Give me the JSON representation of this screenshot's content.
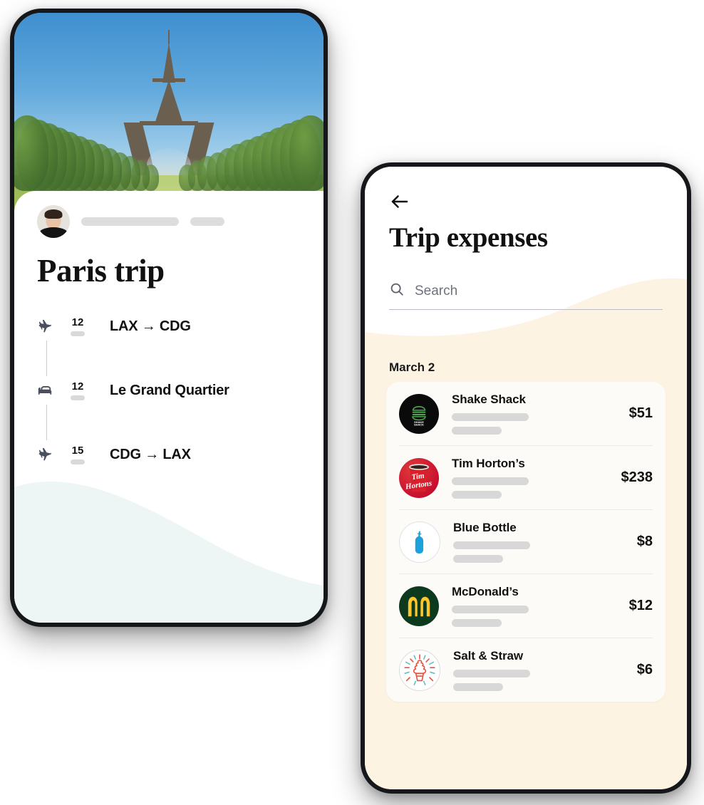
{
  "left_phone": {
    "hero": {
      "image_alt": "eiffel-tower-champ-de-mars"
    },
    "profile": {
      "avatar_alt": "user-avatar"
    },
    "title": "Paris trip",
    "itinerary": [
      {
        "icon": "plane-icon",
        "day": "12",
        "label": "LAX → CDG"
      },
      {
        "icon": "bed-icon",
        "day": "12",
        "label": "Le Grand Quartier"
      },
      {
        "icon": "plane-icon",
        "day": "15",
        "label": "CDG → LAX"
      }
    ]
  },
  "right_phone": {
    "back_icon": "arrow-left-icon",
    "title": "Trip expenses",
    "search": {
      "icon": "search-icon",
      "placeholder": "Search",
      "value": ""
    },
    "date_heading": "March 2",
    "expenses": [
      {
        "merchant": "Shake Shack",
        "amount": "$51",
        "logo": "shake-shack-logo"
      },
      {
        "merchant": "Tim Horton’s",
        "amount": "$238",
        "logo": "tim-hortons-logo"
      },
      {
        "merchant": "Blue Bottle",
        "amount": "$8",
        "logo": "blue-bottle-logo"
      },
      {
        "merchant": "McDonald’s",
        "amount": "$12",
        "logo": "mcdonalds-logo"
      },
      {
        "merchant": "Salt & Straw",
        "amount": "$6",
        "logo": "salt-and-straw-logo"
      }
    ]
  },
  "colors": {
    "cream_bg": "#FDF3E2",
    "card_bg": "#FCFBF8",
    "mint_wave": "#EDF6F4",
    "skeleton": "#D8D8D8",
    "text_primary": "#111111",
    "shake_shack_green": "#4FA64F",
    "tim_hortons_red": "#C8102E",
    "blue_bottle_blue": "#1DA1DC",
    "mcdonalds_green": "#0D3A1F",
    "mcdonalds_yellow": "#FFC72C",
    "salt_straw_red": "#E8523F",
    "salt_straw_teal": "#5FC4C0"
  }
}
